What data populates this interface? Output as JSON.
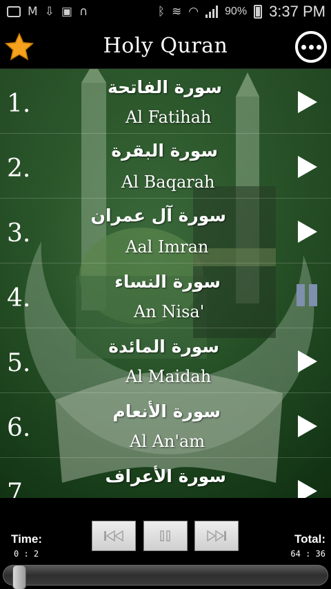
{
  "status_bar": {
    "battery_percent": "90%",
    "time": "3:37 PM"
  },
  "app": {
    "title": "Holy Quran"
  },
  "surahs": [
    {
      "number": "1.",
      "arabic": "سورة الفاتحة",
      "latin": "Al Fatihah",
      "state": "play"
    },
    {
      "number": "2.",
      "arabic": "سورة البقرة",
      "latin": "Al Baqarah",
      "state": "play"
    },
    {
      "number": "3.",
      "arabic": "سورة آل عمران",
      "latin": "Aal Imran",
      "state": "play"
    },
    {
      "number": "4.",
      "arabic": "سورة النساء",
      "latin": "An Nisa'",
      "state": "pause"
    },
    {
      "number": "5.",
      "arabic": "سورة المائدة",
      "latin": "Al Maidah",
      "state": "play"
    },
    {
      "number": "6.",
      "arabic": "سورة الأنعام",
      "latin": "Al An'am",
      "state": "play"
    },
    {
      "number": "7",
      "arabic": "سورة الأعراف",
      "latin": "",
      "state": "play"
    }
  ],
  "player": {
    "time_label": "Time:",
    "time_value": "0 : 2",
    "total_label": "Total:",
    "total_value": "64 : 36",
    "progress_fraction": 0.03
  },
  "colors": {
    "accent_star": "#f6a21e",
    "pause_icon": "#7f8fae",
    "list_bg": "#1f4a20"
  },
  "icons": {
    "favorite": "star-icon",
    "overflow": "more-icon",
    "row_play": "play-icon",
    "row_pause": "pause-icon",
    "prev": "skip-back-icon",
    "pause_ctrl": "pause-icon",
    "next": "skip-forward-icon"
  }
}
